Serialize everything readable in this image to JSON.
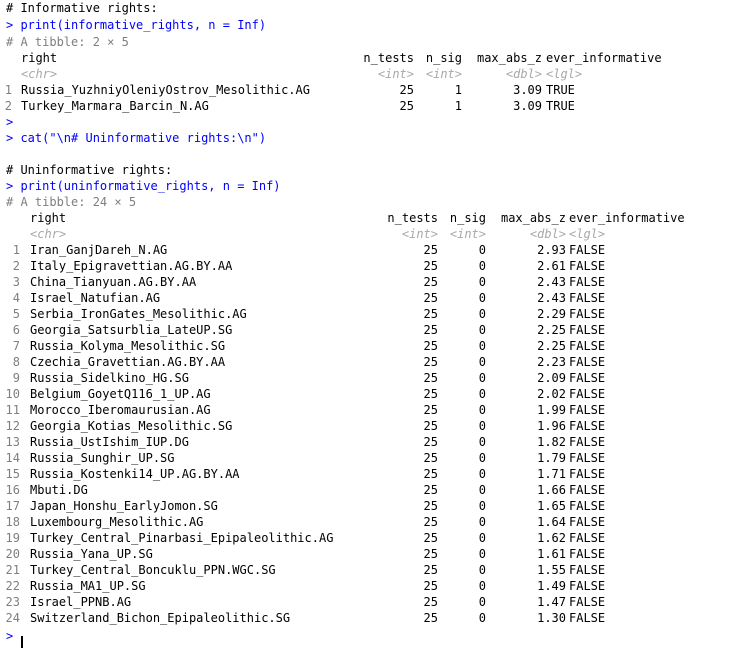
{
  "console": {
    "prompt": ">",
    "comment_prefix": "#",
    "top": {
      "title_comment": "# Informative rights:",
      "print_cmd": "> print(informative_rights, n = Inf)",
      "tibble_info": "# A tibble: 2 × 5",
      "headers": [
        "right",
        "n_tests",
        "n_sig",
        "max_abs_z",
        "ever_informative"
      ],
      "types": [
        "<chr>",
        "<int>",
        "<int>",
        "<dbl>",
        "<lgl>"
      ],
      "rows": [
        {
          "idx": "1",
          "right": "Russia_YuzhniyOleniyOstrov_Mesolithic.AG",
          "n_tests": "25",
          "n_sig": "1",
          "max_abs_z": "3.09",
          "ever_informative": "TRUE"
        },
        {
          "idx": "2",
          "right": "Turkey_Marmara_Barcin_N.AG",
          "n_tests": "25",
          "n_sig": "1",
          "max_abs_z": "3.09",
          "ever_informative": "TRUE"
        }
      ]
    },
    "blank_prompt": ">",
    "cat_cmd": "> cat(\"\\n# Uninformative rights:\\n\")",
    "bottom": {
      "title_comment": "# Uninformative rights:",
      "print_cmd": "> print(uninformative_rights, n = Inf)",
      "tibble_info": "# A tibble: 24 × 5",
      "headers": [
        "right",
        "n_tests",
        "n_sig",
        "max_abs_z",
        "ever_informative"
      ],
      "types": [
        "<chr>",
        "<int>",
        "<int>",
        "<dbl>",
        "<lgl>"
      ],
      "rows": [
        {
          "idx": "1",
          "right": "Iran_GanjDareh_N.AG",
          "n_tests": "25",
          "n_sig": "0",
          "max_abs_z": "2.93",
          "ever_informative": "FALSE"
        },
        {
          "idx": "2",
          "right": "Italy_Epigravettian.AG.BY.AA",
          "n_tests": "25",
          "n_sig": "0",
          "max_abs_z": "2.61",
          "ever_informative": "FALSE"
        },
        {
          "idx": "3",
          "right": "China_Tianyuan.AG.BY.AA",
          "n_tests": "25",
          "n_sig": "0",
          "max_abs_z": "2.43",
          "ever_informative": "FALSE"
        },
        {
          "idx": "4",
          "right": "Israel_Natufian.AG",
          "n_tests": "25",
          "n_sig": "0",
          "max_abs_z": "2.43",
          "ever_informative": "FALSE"
        },
        {
          "idx": "5",
          "right": "Serbia_IronGates_Mesolithic.AG",
          "n_tests": "25",
          "n_sig": "0",
          "max_abs_z": "2.29",
          "ever_informative": "FALSE"
        },
        {
          "idx": "6",
          "right": "Georgia_Satsurblia_LateUP.SG",
          "n_tests": "25",
          "n_sig": "0",
          "max_abs_z": "2.25",
          "ever_informative": "FALSE"
        },
        {
          "idx": "7",
          "right": "Russia_Kolyma_Mesolithic.SG",
          "n_tests": "25",
          "n_sig": "0",
          "max_abs_z": "2.25",
          "ever_informative": "FALSE"
        },
        {
          "idx": "8",
          "right": "Czechia_Gravettian.AG.BY.AA",
          "n_tests": "25",
          "n_sig": "0",
          "max_abs_z": "2.23",
          "ever_informative": "FALSE"
        },
        {
          "idx": "9",
          "right": "Russia_Sidelkino_HG.SG",
          "n_tests": "25",
          "n_sig": "0",
          "max_abs_z": "2.09",
          "ever_informative": "FALSE"
        },
        {
          "idx": "10",
          "right": "Belgium_GoyetQ116_1_UP.AG",
          "n_tests": "25",
          "n_sig": "0",
          "max_abs_z": "2.02",
          "ever_informative": "FALSE"
        },
        {
          "idx": "11",
          "right": "Morocco_Iberomaurusian.AG",
          "n_tests": "25",
          "n_sig": "0",
          "max_abs_z": "1.99",
          "ever_informative": "FALSE"
        },
        {
          "idx": "12",
          "right": "Georgia_Kotias_Mesolithic.SG",
          "n_tests": "25",
          "n_sig": "0",
          "max_abs_z": "1.96",
          "ever_informative": "FALSE"
        },
        {
          "idx": "13",
          "right": "Russia_UstIshim_IUP.DG",
          "n_tests": "25",
          "n_sig": "0",
          "max_abs_z": "1.82",
          "ever_informative": "FALSE"
        },
        {
          "idx": "14",
          "right": "Russia_Sunghir_UP.SG",
          "n_tests": "25",
          "n_sig": "0",
          "max_abs_z": "1.79",
          "ever_informative": "FALSE"
        },
        {
          "idx": "15",
          "right": "Russia_Kostenki14_UP.AG.BY.AA",
          "n_tests": "25",
          "n_sig": "0",
          "max_abs_z": "1.71",
          "ever_informative": "FALSE"
        },
        {
          "idx": "16",
          "right": "Mbuti.DG",
          "n_tests": "25",
          "n_sig": "0",
          "max_abs_z": "1.66",
          "ever_informative": "FALSE"
        },
        {
          "idx": "17",
          "right": "Japan_Honshu_EarlyJomon.SG",
          "n_tests": "25",
          "n_sig": "0",
          "max_abs_z": "1.65",
          "ever_informative": "FALSE"
        },
        {
          "idx": "18",
          "right": "Luxembourg_Mesolithic.AG",
          "n_tests": "25",
          "n_sig": "0",
          "max_abs_z": "1.64",
          "ever_informative": "FALSE"
        },
        {
          "idx": "19",
          "right": "Turkey_Central_Pinarbasi_Epipaleolithic.AG",
          "n_tests": "25",
          "n_sig": "0",
          "max_abs_z": "1.62",
          "ever_informative": "FALSE"
        },
        {
          "idx": "20",
          "right": "Russia_Yana_UP.SG",
          "n_tests": "25",
          "n_sig": "0",
          "max_abs_z": "1.61",
          "ever_informative": "FALSE"
        },
        {
          "idx": "21",
          "right": "Turkey_Central_Boncuklu_PPN.WGC.SG",
          "n_tests": "25",
          "n_sig": "0",
          "max_abs_z": "1.55",
          "ever_informative": "FALSE"
        },
        {
          "idx": "22",
          "right": "Russia_MA1_UP.SG",
          "n_tests": "25",
          "n_sig": "0",
          "max_abs_z": "1.49",
          "ever_informative": "FALSE"
        },
        {
          "idx": "23",
          "right": "Israel_PPNB.AG",
          "n_tests": "25",
          "n_sig": "0",
          "max_abs_z": "1.47",
          "ever_informative": "FALSE"
        },
        {
          "idx": "24",
          "right": "Switzerland_Bichon_Epipaleolithic.SG",
          "n_tests": "25",
          "n_sig": "0",
          "max_abs_z": "1.30",
          "ever_informative": "FALSE"
        }
      ]
    },
    "final_prompt": ">"
  },
  "colors": {
    "command": "#0000ff",
    "comment_gray": "#7f7f7f",
    "type_gray": "#a8a8a8",
    "text": "#000000",
    "background": "#ffffff"
  }
}
